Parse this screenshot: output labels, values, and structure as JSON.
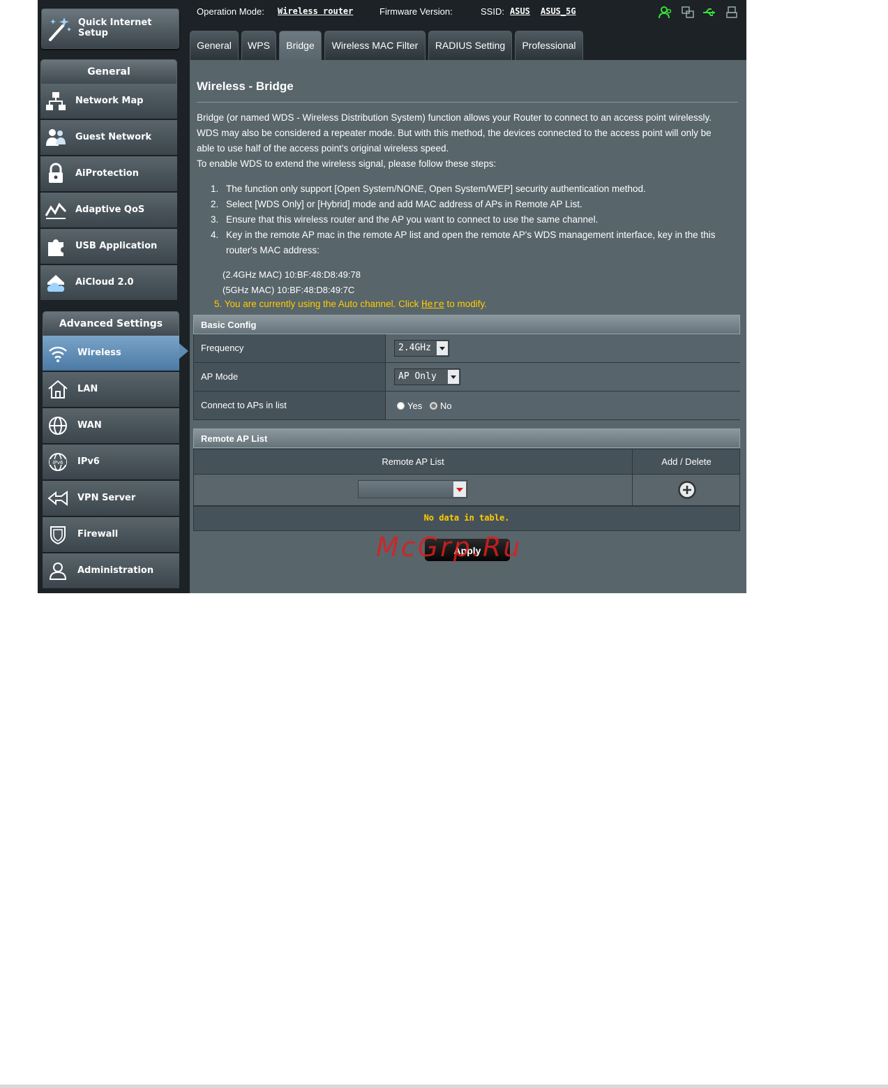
{
  "sidebar": {
    "quick_setup": "Quick Internet Setup",
    "general_header": "General",
    "general_items": [
      {
        "label": "Network Map",
        "icon": "network-map-icon"
      },
      {
        "label": "Guest Network",
        "icon": "guest-network-icon"
      },
      {
        "label": "AiProtection",
        "icon": "lock-icon"
      },
      {
        "label": "Adaptive QoS",
        "icon": "qos-graph-icon"
      },
      {
        "label": "USB Application",
        "icon": "puzzle-icon"
      },
      {
        "label": "AiCloud 2.0",
        "icon": "cloud-house-icon"
      }
    ],
    "advanced_header": "Advanced Settings",
    "advanced_items": [
      {
        "label": "Wireless",
        "icon": "wifi-icon",
        "active": true
      },
      {
        "label": "LAN",
        "icon": "house-icon"
      },
      {
        "label": "WAN",
        "icon": "globe-icon"
      },
      {
        "label": "IPv6",
        "icon": "ipv6-globe-icon"
      },
      {
        "label": "VPN Server",
        "icon": "vpn-icon"
      },
      {
        "label": "Firewall",
        "icon": "shield-icon"
      },
      {
        "label": "Administration",
        "icon": "user-icon"
      }
    ]
  },
  "topbar": {
    "op_mode_label": "Operation Mode:",
    "op_mode_value": "Wireless router",
    "firmware_label": "Firmware Version:",
    "ssid_label": "SSID:",
    "ssid_1": "ASUS",
    "ssid_2": "ASUS_5G",
    "status_color": "#3adf3a"
  },
  "tabs": [
    "General",
    "WPS",
    "Bridge",
    "Wireless MAC Filter",
    "RADIUS Setting",
    "Professional"
  ],
  "content": {
    "title": "Wireless - Bridge",
    "desc_1": "Bridge (or named WDS - Wireless Distribution System) function allows your Router to connect to an access point wirelessly.",
    "desc_2": "WDS may also be considered a repeater mode. But with this method, the devices connected to the access point will only be",
    "desc_3": "able to use half of the access point's original wireless speed.",
    "desc_4": "To enable WDS to extend the wireless signal, please follow these steps:",
    "steps": [
      {
        "n": "1.",
        "t": "The function only support [Open System/NONE, Open System/WEP] security authentication method."
      },
      {
        "n": "2.",
        "t": "Select [WDS Only] or [Hybrid] mode and add MAC address of APs in Remote AP List."
      },
      {
        "n": "3.",
        "t": "Ensure that this wireless router and the AP you want to connect to use the same channel."
      },
      {
        "n": "4.",
        "t": "Key in the remote AP mac in the remote AP list and open the remote AP's WDS management interface, key in the this router's MAC address:"
      }
    ],
    "mac_24": "(2.4GHz MAC) 10:BF:48:D8:49:78",
    "mac_5": "(5GHz MAC) 10:BF:48:D8:49:7C",
    "note5_pre": "5. You are currently using the Auto channel. Click ",
    "note5_link": "Here",
    "note5_post": " to modify."
  },
  "basic_config": {
    "header": "Basic Config",
    "frequency_label": "Frequency",
    "frequency_value": "2.4GHz",
    "ap_mode_label": "AP Mode",
    "ap_mode_value": "AP Only",
    "connect_label": "Connect to APs in list",
    "yes": "Yes",
    "no": "No",
    "connect_selected": "No"
  },
  "remote_ap": {
    "header": "Remote AP List",
    "col_list": "Remote AP List",
    "col_add": "Add / Delete",
    "select_value": "",
    "no_data": "No data in table."
  },
  "apply_label": "Apply",
  "watermark": "McGrp.Ru"
}
